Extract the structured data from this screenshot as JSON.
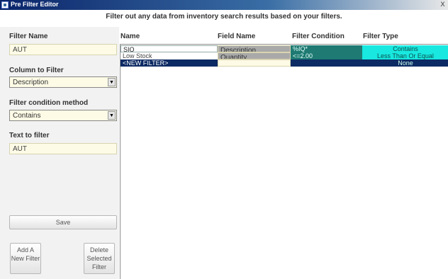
{
  "window": {
    "title": "Pre Filter Editor",
    "close_glyph": "X"
  },
  "instruction": "Filter out any data from inventory search results based on your filters.",
  "left_panel": {
    "filter_name_label": "Filter Name",
    "filter_name_value": "AUT",
    "column_label": "Column to Filter",
    "column_value": "Description",
    "method_label": "Filter condition method",
    "method_value": "Contains",
    "text_label": "Text to filter",
    "text_value": "AUT",
    "save_label": "Save",
    "add_label": "Add A New Filter",
    "delete_label": "Delete Selected Filter"
  },
  "grid": {
    "columns": [
      "Name",
      "Field Name",
      "Filter Condition",
      "Filter Type"
    ],
    "rows": [
      {
        "name": "SIQ",
        "field": "Description",
        "condition": "%IQ*",
        "type": "Contains"
      },
      {
        "name": "Low Stock",
        "field": "Quantity",
        "condition": "<=2.00",
        "type": "Less Than Or Equal"
      },
      {
        "name": "<NEW FILTER>",
        "field": "",
        "condition": "",
        "type": "None"
      }
    ]
  },
  "colors": {
    "selected_row": "#0c2a63",
    "field_cell": "#a9a9a9",
    "condition_cell": "#1e7a72",
    "type_cell": "#18e8e0",
    "input_bg": "#fdfbe6"
  },
  "icons": {
    "window": "app-icon",
    "dropdown": "chevron-down-icon"
  }
}
